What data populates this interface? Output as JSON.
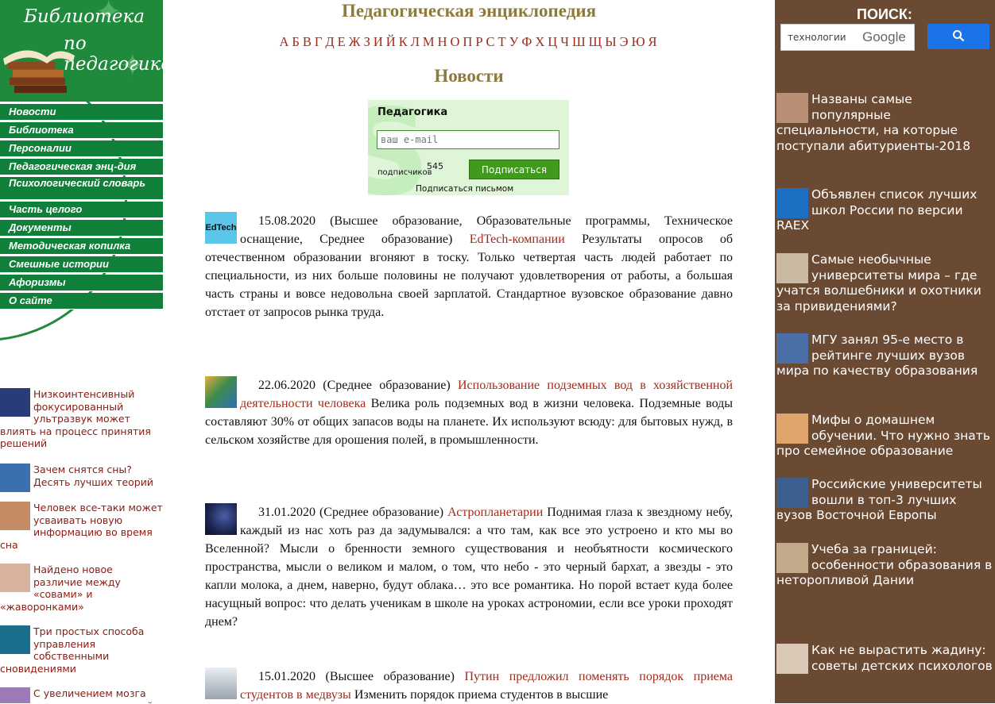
{
  "logo": {
    "line1": "Библиотека",
    "line2": "по педагогике"
  },
  "nav": [
    "Новости",
    "Библиотека",
    "Персоналии",
    "Педагогическая энц-дия",
    "Психологический словарь",
    "Часть целого",
    "Документы",
    "Методическая копилка",
    "Смешные истории",
    "Афоризмы",
    "О сайте"
  ],
  "left_news": [
    {
      "text": "Низкоинтенсивный фокусированный ультразвук может влиять на процесс принятия решений",
      "thumb_color": "#2a3b7a"
    },
    {
      "text": "Зачем снятся сны? Десять лучших теорий",
      "thumb_color": "#3a6fb0"
    },
    {
      "text": "Человек все-таки может усваивать новую информацию во время сна",
      "thumb_color": "#c58b64"
    },
    {
      "text": "Найдено новое различие между «совами» и «жаворонками»",
      "thumb_color": "#d9b2a0"
    },
    {
      "text": "Три простых способа управления собственными сновидениями",
      "thumb_color": "#1b6d8c"
    },
    {
      "text": "С увеличением мозга растет относительный",
      "thumb_color": "#9b7bb8"
    }
  ],
  "header": {
    "site_title": "Педагогическая энциклопедия",
    "alphabet": [
      "А",
      "Б",
      "В",
      "Г",
      "Д",
      "Е",
      "Ж",
      "З",
      "И",
      "Й",
      "К",
      "Л",
      "М",
      "Н",
      "О",
      "П",
      "Р",
      "С",
      "Т",
      "У",
      "Ф",
      "Х",
      "Ц",
      "Ч",
      "Ш",
      "Щ",
      "Ы",
      "Э",
      "Ю",
      "Я"
    ],
    "section_title": "Новости"
  },
  "subscribe": {
    "title": "Педагогика",
    "email_placeholder": "ваш e-mail",
    "count": "545",
    "count_label": "подписчиков",
    "button": "Подписаться",
    "by_letter": "Подписаться письмом"
  },
  "articles": [
    {
      "date": "15.08.2020",
      "tags": "(Высшее образование, Образовательные программы, Техническое оснащение, Среднее образование)",
      "title": "EdTech-компании",
      "body": "Результаты опросов об отечественном образовании вгоняют в тоску. Только четвертая часть людей работает по специальности, из них больше половины не получают удовлетворения от работы, а большая часть страны и вовсе недовольна своей зарплатой. Стандартное вузовское образование давно отстает от запросов рынка труда.",
      "thumb_label": "EdTech",
      "thumb_color": "#5bc6e8"
    },
    {
      "date": "22.06.2020",
      "tags": "(Среднее образование)",
      "title": "Использование подземных вод в хозяйственной деятельности человека",
      "body": "Велика роль подземных вод в жизни человека. Подземные воды составляют 30% от общих запасов воды на планете. Их используют всюду: для бытовых нужд, в сельском хозяйстве для орошения полей, в промышленности.",
      "thumb_label": "",
      "thumb_color": "#3f8b4a"
    },
    {
      "date": "31.01.2020",
      "tags": "(Среднее образование)",
      "title": "Астропланетарии",
      "body": "Поднимая глаза к звездному небу, каждый из нас хоть раз да задумывался: а что там, как все это устроено и кто мы во Вселенной? Мысли о бренности земного существования и необъятности космического пространства, мысли о великом и малом, о том, что небо - это черный бархат, а звезды - это капли молока, а днем, наверно, будут облака… это все романтика. Но порой встает куда более насущный вопрос: что делать ученикам в школе на уроках астрономии, если все уроки проходят днем?",
      "thumb_label": "",
      "thumb_color": "#1c2550"
    },
    {
      "date": "15.01.2020",
      "tags": "(Высшее образование)",
      "title": "Путин предложил поменять порядок приема студентов в медвузы",
      "body": "Изменить порядок приема студентов в высшие",
      "thumb_label": "",
      "thumb_color": "#c9cfd6"
    }
  ],
  "search": {
    "label": "ПОИСК:",
    "value": "технологии",
    "brand": "Google"
  },
  "right_news": [
    {
      "text": "Названы самые популярные специальности, на которые поступали абитуриенты-2018",
      "thumb_color": "#b88e74"
    },
    {
      "text": "Объявлен список лучших школ России по версии RAEX",
      "thumb_color": "#1d6fc4"
    },
    {
      "text": "Самые необычные университеты мира – где учатся волшебники и охотники за привидениями?",
      "thumb_color": "#c9b9a3"
    },
    {
      "text": "МГУ занял 95-е место в рейтинге лучших вузов мира по качеству образования",
      "thumb_color": "#4a6ea8"
    },
    {
      "text": "Мифы о домашнем обучении. Что нужно знать про семейное образование",
      "thumb_color": "#e0a36b"
    },
    {
      "text": "Российские университеты вошли в топ-3 лучших вузов Восточной Европы",
      "thumb_color": "#3d5f8e"
    },
    {
      "text": "Учеба за границей: особенности образования в неторопливой Дании",
      "thumb_color": "#c2a98a"
    },
    {
      "text": "Как не вырастить жадину: советы детских психологов",
      "thumb_color": "#d9c8b5"
    }
  ]
}
